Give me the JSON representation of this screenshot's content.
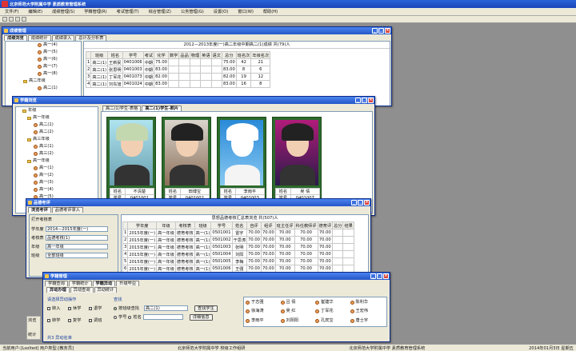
{
  "app": {
    "title": "北京师范大学附属中学 素质教育管理系统",
    "menu": [
      "文件(F)",
      "编辑(E)",
      "成绩管理(S)",
      "学籍管理(R)",
      "考试管理(T)",
      "综合管理(Z)",
      "公务管理(G)",
      "设置(O)",
      "窗口(W)",
      "帮助(H)"
    ]
  },
  "grades": {
    "title": "成绩管理",
    "tabs": [
      "成绩浏览",
      "成绩统计",
      "成绩录入",
      "总计及分析表"
    ],
    "tree": [
      "高一(4)",
      "高一(5)",
      "高一(6)",
      "高一(7)",
      "高一(8)",
      "高二年级",
      "高二(1)"
    ],
    "heading": "2012—2013年度(一)高二年级中期高二(1)成绩 共(79)人",
    "columns": [
      "",
      "班级",
      "姓名",
      "学号",
      "考试",
      "化学",
      "数学",
      "品品",
      "物理",
      "英语",
      "语文",
      "总分",
      "班名次",
      "年级名次"
    ],
    "rows": [
      [
        "1",
        "高二(1)",
        "王新民",
        "0401006",
        "中期",
        "75.00",
        "",
        "",
        "",
        "",
        "",
        "75.00",
        "42",
        "21"
      ],
      [
        "2",
        "高二(1)",
        "张思明",
        "0401003",
        "中期",
        "83.00",
        "",
        "",
        "",
        "",
        "",
        "83.00",
        "8",
        "6"
      ],
      [
        "3",
        "高二(1)",
        "丁军花",
        "0401073",
        "中期",
        "82.00",
        "",
        "",
        "",
        "",
        "",
        "82.00",
        "19",
        "12"
      ],
      [
        "4",
        "高二(1)",
        "刘东旭",
        "0401024",
        "中期",
        "83.00",
        "",
        "",
        "",
        "",
        "",
        "83.00",
        "16",
        "8"
      ]
    ]
  },
  "students": {
    "title": "学籍浏览",
    "tabs": [
      "高二(1)学生-表格",
      "高二(1)学生-照片"
    ],
    "tree": [
      "年级",
      "高一年级",
      "高二(1)",
      "高二(2)",
      "高三年级",
      "高三(1)",
      "高三(2)",
      "高一年级",
      "高一(1)",
      "高一(2)",
      "高一(3)",
      "高一(4)",
      "高一(5)",
      "高一(6)"
    ],
    "cards": [
      {
        "name": "不清楚",
        "id": "0401001"
      },
      {
        "name": "田博宝",
        "id": "0401002"
      },
      {
        "name": "李雨平",
        "id": "0401003"
      },
      {
        "name": "吴 倩",
        "id": "0401007"
      }
    ],
    "name_label": "姓名",
    "id_label": "学号"
  },
  "quality": {
    "title": "品德考评",
    "tabs": [
      "浏览考评",
      "品德考评录入"
    ],
    "search_title": "打开考核表",
    "school_year_label": "学年度",
    "school_year": "2014—2015年度(一)",
    "type_label": "考核表",
    "type": "品德考核(1)",
    "grade_label": "年级",
    "grade": "高一年级",
    "class_label": "班级",
    "class": "全部班级",
    "heading": "思想品德考核汇总表浏览  共(507)人",
    "columns": [
      "",
      "学年度",
      "年级",
      "考核表",
      "班级",
      "学号",
      "姓名",
      "自评",
      "组评",
      "班主任评",
      "科任教师评",
      "德育评",
      "总分",
      "结果"
    ],
    "rows": [
      [
        "1",
        "2015年度(一)",
        "高一年级",
        "德育考核",
        "高一(1)",
        "0501001",
        "雷宇",
        "70.00",
        "70.00",
        "70.00",
        "70.00",
        "70.00",
        "",
        ""
      ],
      [
        "2",
        "2015年度(一)",
        "高一年级",
        "德育考核",
        "高一(1)",
        "0501002",
        "于思涛",
        "70.00",
        "70.00",
        "70.00",
        "70.00",
        "70.00",
        "",
        ""
      ],
      [
        "3",
        "2015年度(一)",
        "高一年级",
        "德育考核",
        "高一(1)",
        "0501003",
        "张明",
        "70.00",
        "70.00",
        "70.00",
        "70.00",
        "70.00",
        "",
        ""
      ],
      [
        "4",
        "2015年度(一)",
        "高一年级",
        "德育考核",
        "高一(1)",
        "0501004",
        "刘阳",
        "70.00",
        "70.00",
        "70.00",
        "70.00",
        "70.00",
        "",
        ""
      ],
      [
        "5",
        "2015年度(一)",
        "高一年级",
        "德育考核",
        "高一(1)",
        "0501005",
        "李梅",
        "70.00",
        "70.00",
        "70.00",
        "70.00",
        "70.00",
        "",
        ""
      ],
      [
        "6",
        "2015年度(一)",
        "高一年级",
        "德育考核",
        "高一(1)",
        "0501006",
        "王强",
        "70.00",
        "70.00",
        "70.00",
        "70.00",
        "70.00",
        "",
        ""
      ]
    ],
    "side_labels": [
      "浏览",
      "",
      "统计"
    ]
  },
  "mgmt": {
    "title": "学籍管理",
    "tabs": [
      "学籍查询",
      "学籍统计",
      "学籍异动",
      "升级毕业"
    ],
    "subtabs": [
      "异动办理",
      "异动查询",
      "异动统计"
    ],
    "section_title": "请选择异动操作",
    "ops": [
      "转入",
      "休学",
      "退学",
      "转学",
      "复学",
      "调班"
    ],
    "query_title": "查找",
    "query_opts": [
      "按班级查找",
      "学号",
      "姓名"
    ],
    "query_class": "高二(1)",
    "btn_find": "查找学生",
    "btn_detail": "详细信息",
    "people": [
      [
        "于志强",
        "吕 倩",
        "崔建华",
        "陈利华"
      ],
      [
        "徐海涛",
        "吴 红",
        "丁军花",
        "王宏伟"
      ],
      [
        "李雨平",
        "刘阳阳",
        "孔宾宝",
        "唐士宇"
      ]
    ],
    "footer": "共3 异动名单"
  },
  "status": {
    "user": "当前用户:[Lsolted] 用户类型:[教务员]",
    "school": "北京师范大学附属中学 校级工作组研",
    "sys": "北京师范大学附属中学 素质教育管理系统",
    "date": "2014年01月3日 星期五"
  }
}
